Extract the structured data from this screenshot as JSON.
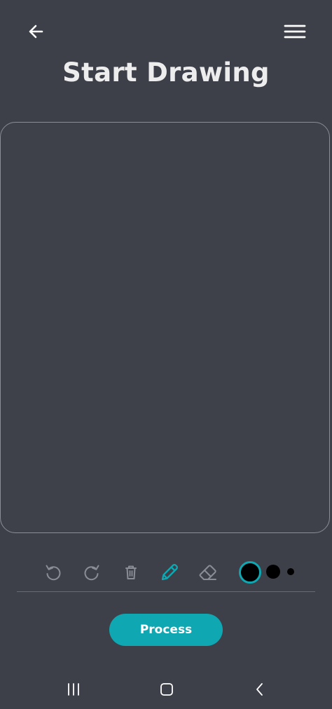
{
  "header": {
    "title": "Start Drawing",
    "back_icon": "arrow-left-icon",
    "menu_icon": "hamburger-menu-icon"
  },
  "toolbar": {
    "tools": [
      {
        "name": "undo",
        "icon": "undo-icon",
        "active": false
      },
      {
        "name": "redo",
        "icon": "redo-icon",
        "active": false
      },
      {
        "name": "delete",
        "icon": "trash-icon",
        "active": false
      },
      {
        "name": "pencil",
        "icon": "pencil-icon",
        "active": true
      },
      {
        "name": "eraser",
        "icon": "eraser-icon",
        "active": false
      }
    ],
    "brush_sizes": [
      "large",
      "medium",
      "small"
    ],
    "selected_brush_size": "large",
    "brush_color": "#000000"
  },
  "actions": {
    "process_label": "Process"
  },
  "colors": {
    "background": "#3d4049",
    "accent": "#0fa7b1",
    "inactive_icon": "#8a8d95"
  },
  "system_nav": {
    "recents_icon": "recent-apps-icon",
    "home_icon": "home-icon",
    "back_icon": "system-back-icon"
  }
}
